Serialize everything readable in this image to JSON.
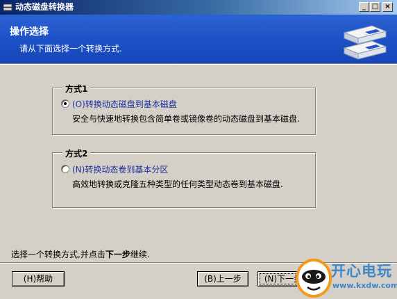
{
  "window": {
    "title": "动态磁盘转换器",
    "minimize_glyph": "_",
    "maximize_glyph": "□",
    "close_glyph": "×"
  },
  "header": {
    "title": "操作选择",
    "subtitle": "请从下面选择一个转换方式."
  },
  "options": [
    {
      "group_label": "方式1",
      "label": "(O)转换动态磁盘到基本磁盘",
      "description": "安全与快速地转换包含简单卷或镜像卷的动态磁盘到基本磁盘.",
      "checked": true
    },
    {
      "group_label": "方式2",
      "label": "(N)转换动态卷到基本分区",
      "description": "高效地转换或克隆五种类型的任何类型动态卷到基本磁盘.",
      "checked": false
    }
  ],
  "footer": {
    "text_before": "选择一个转换方式,并点击",
    "text_bold": "下一步",
    "text_after": "继续."
  },
  "buttons": {
    "help": "(H)帮助",
    "back": "(B)上一步",
    "next": "(N)下一步"
  },
  "watermark": {
    "brand": "开心电玩",
    "url": "www.kxdw.com"
  },
  "colors": {
    "header_blue": "#1b4fc4",
    "title_bar": "#0a246a",
    "option_label": "#1c30a0",
    "watermark": "#3f86c8"
  },
  "icons": {
    "app": "app-disk-icon",
    "header": "dynamic-disks-icon",
    "watermark": "mascot-face-icon"
  }
}
